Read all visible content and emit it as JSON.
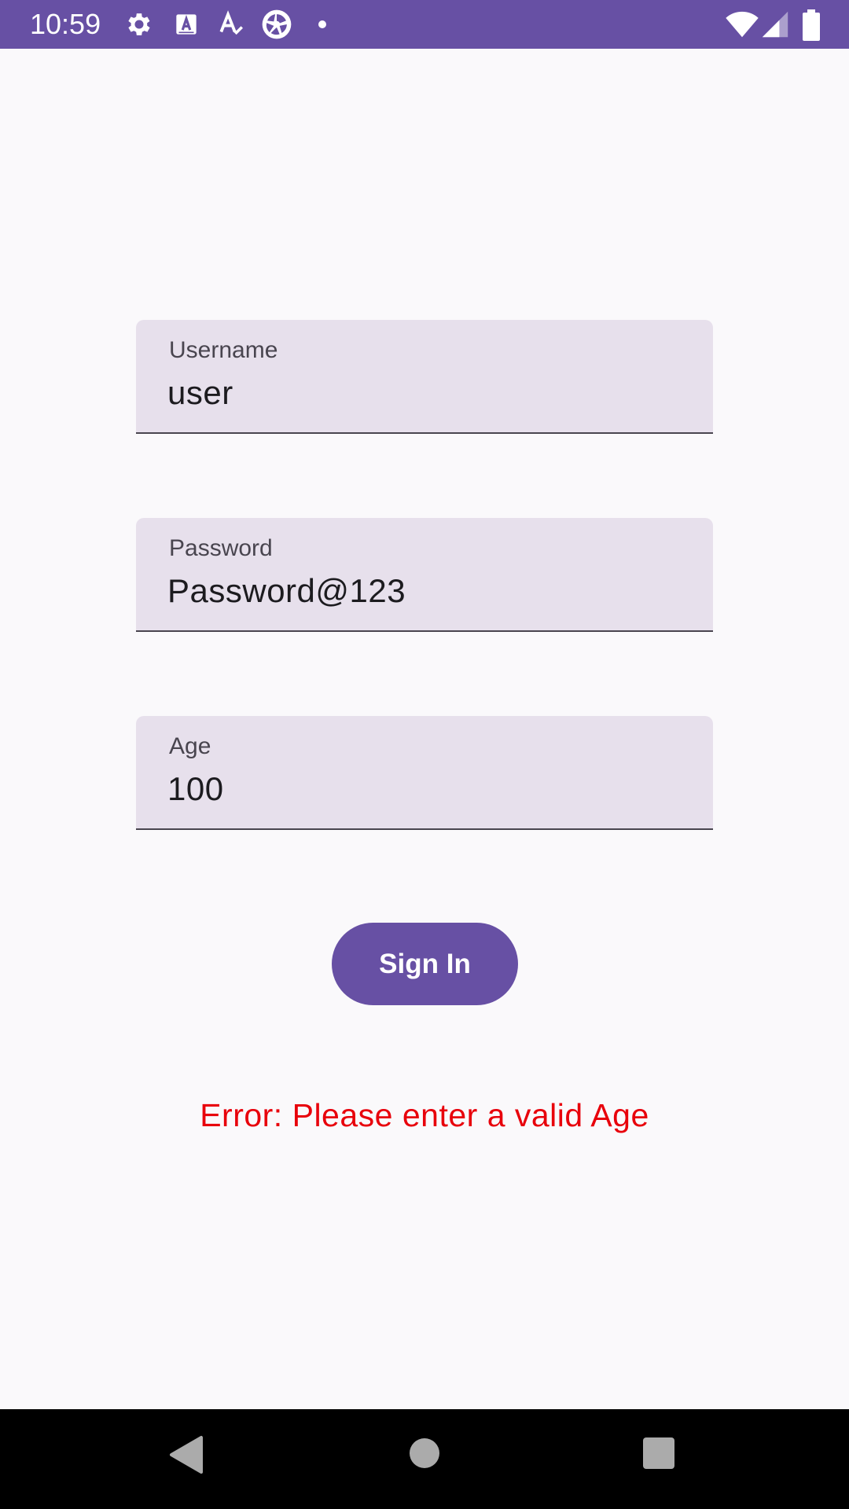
{
  "status_bar": {
    "time": "10:59",
    "icons": [
      "settings-icon",
      "a-box-icon",
      "a-check-icon",
      "aperture-icon",
      "dot-icon"
    ],
    "right_icons": [
      "wifi-icon",
      "signal-icon",
      "battery-icon"
    ],
    "color": "#6750a4"
  },
  "form": {
    "username": {
      "label": "Username",
      "value": "user"
    },
    "password": {
      "label": "Password",
      "value": "Password@123"
    },
    "age": {
      "label": "Age",
      "value": "100"
    },
    "signin_label": "Sign In",
    "error": "Error: Please enter a valid Age"
  },
  "colors": {
    "accent": "#6750a4",
    "field_bg": "#e7e0ec",
    "error": "#e8000b"
  },
  "nav_bar": {
    "buttons": [
      "back-icon",
      "home-icon",
      "recents-icon"
    ]
  }
}
